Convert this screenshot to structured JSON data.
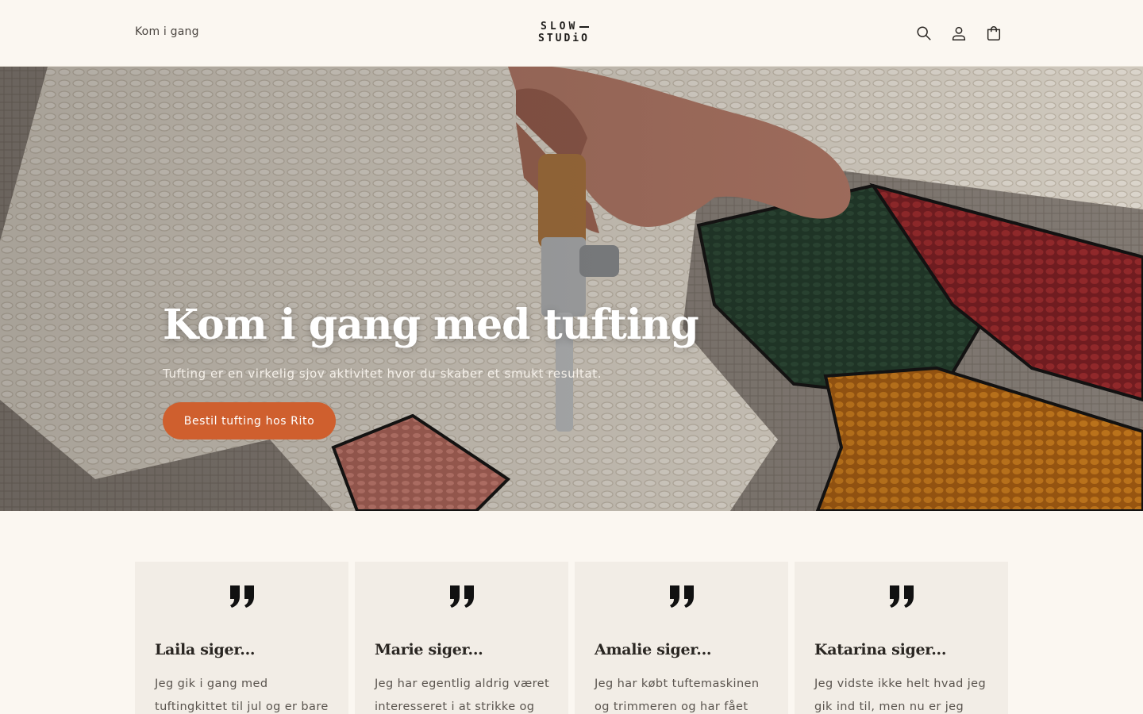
{
  "header": {
    "nav_link": "Kom i gang",
    "logo_line1": "SLOW",
    "logo_line2": "STUDiO",
    "icons": [
      "search-icon",
      "account-icon",
      "cart-icon"
    ]
  },
  "hero": {
    "title": "Kom i gang med tufting",
    "subtitle": "Tufting er en virkelig sjov aktivitet hvor du skaber et smukt resultat.",
    "button_label": "Bestil tufting hos Rito",
    "accent_color": "#cf5f2e"
  },
  "testimonials": [
    {
      "name": "Laila siger...",
      "text": "Jeg gik i gang med tuftingkittet til jul og er bare"
    },
    {
      "name": "Marie siger...",
      "text": "Jeg har egentlig aldrig været interesseret i at strikke og"
    },
    {
      "name": "Amalie siger...",
      "text": "Jeg har købt tuftemaskinen og trimmeren og har fået"
    },
    {
      "name": "Katarina siger...",
      "text": "Jeg vidste ikke helt hvad jeg gik ind til, men nu er jeg"
    }
  ]
}
